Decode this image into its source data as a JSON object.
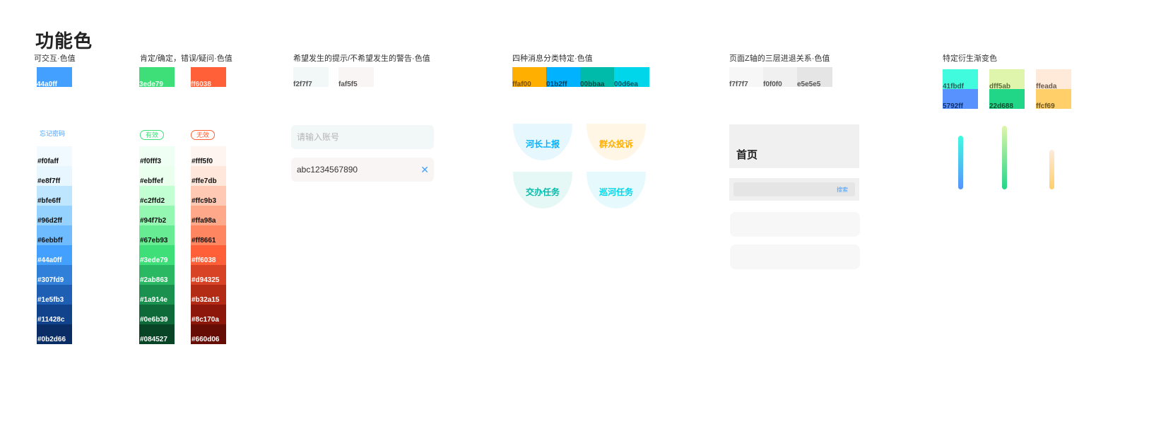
{
  "page_title": "功能色",
  "sections": {
    "interactive": {
      "title": "可交互·色值"
    },
    "confirm_error": {
      "title": "肯定/确定，错误/疑问·色值"
    },
    "hint_warn": {
      "title": "希望发生的提示/不希望发生的警告·色值"
    },
    "message": {
      "title": "四种消息分类特定·色值"
    },
    "z_axis": {
      "title": "页面Z轴的三层进退关系·色值"
    },
    "gradient": {
      "title": "特定衍生渐变色"
    }
  },
  "chips": {
    "blue": {
      "label": "44a0ff",
      "color": "#44a0ff"
    },
    "green": {
      "label": "3ede79",
      "color": "#3ede79"
    },
    "red": {
      "label": "ff6038",
      "color": "#ff6038"
    },
    "hint1": {
      "label": "f2f7f7",
      "color": "#f2f7f7"
    },
    "hint2": {
      "label": "faf5f5",
      "color": "#faf5f5"
    },
    "msg1": {
      "label": "ffaf00",
      "color": "#ffaf00"
    },
    "msg2": {
      "label": "01b2ff",
      "color": "#01b2ff"
    },
    "msg3": {
      "label": "00bbaa",
      "color": "#00bbaa"
    },
    "msg4": {
      "label": "00d6ea",
      "color": "#00d6ea"
    },
    "z1": {
      "label": "f7f7f7",
      "color": "#f7f7f7"
    },
    "z2": {
      "label": "f0f0f0",
      "color": "#f0f0f0"
    },
    "z3": {
      "label": "e5e5e5",
      "color": "#e5e5e5"
    },
    "g1a": {
      "label": "41fbdf",
      "color": "#41fbdf"
    },
    "g1b": {
      "label": "5792ff",
      "color": "#5792ff"
    },
    "g2a": {
      "label": "dff5ab",
      "color": "#dff5ab"
    },
    "g2b": {
      "label": "22d688",
      "color": "#22d688"
    },
    "g3a": {
      "label": "ffeada",
      "color": "#ffeada"
    },
    "g3b": {
      "label": "ffcf69",
      "color": "#ffcf69"
    }
  },
  "forgot_link": "忘记密码",
  "tags": {
    "valid": "有效",
    "invalid": "无效"
  },
  "blue_scale": [
    "#f0faff",
    "#e8f7ff",
    "#bfe6ff",
    "#96d2ff",
    "#6ebbff",
    "#44a0ff",
    "#307fd9",
    "#1e5fb3",
    "#11428c",
    "#0b2d66"
  ],
  "green_scale": [
    "#f0fff3",
    "#ebffef",
    "#c2ffd2",
    "#94f7b2",
    "#67eb93",
    "#3ede79",
    "#2ab863",
    "#1a914e",
    "#0e6b39",
    "#084527"
  ],
  "red_scale": [
    "#fff5f0",
    "#ffe7db",
    "#ffc9b3",
    "#ffa98a",
    "#ff8661",
    "#ff6038",
    "#d94325",
    "#b32a15",
    "#8c170a",
    "#660d06"
  ],
  "inputs": {
    "account_placeholder": "请输入账号",
    "filled_value": "abc1234567890",
    "clear_icon": "close-icon"
  },
  "messages": [
    {
      "label": "河长上报",
      "bg": "#e6f7fd",
      "fg": "#01b2ff"
    },
    {
      "label": "群众投诉",
      "bg": "#fff6e6",
      "fg": "#ffaf00"
    },
    {
      "label": "交办任务",
      "bg": "#e6f8f6",
      "fg": "#00bbaa"
    },
    {
      "label": "巡河任务",
      "bg": "#e6fafd",
      "fg": "#00d6ea"
    }
  ],
  "z_panel": {
    "home": "首页",
    "search": "搜索"
  }
}
